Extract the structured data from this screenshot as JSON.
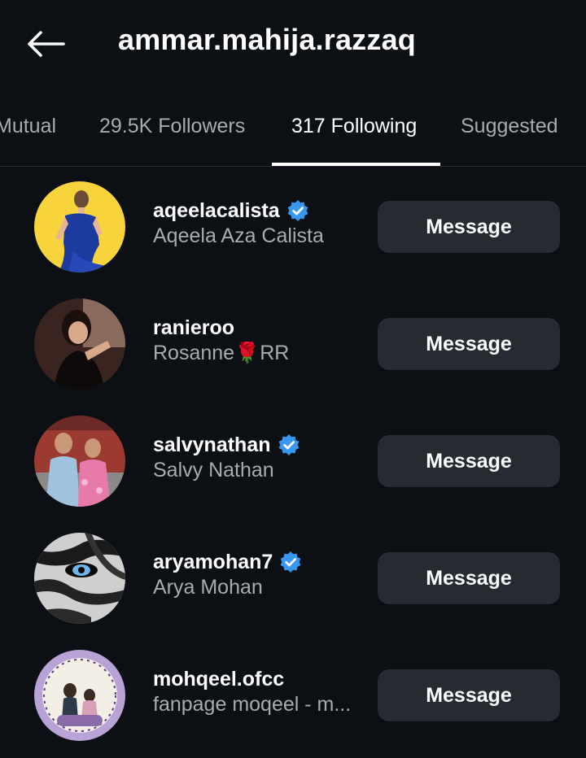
{
  "header": {
    "title": "ammar.mahija.razzaq",
    "back_icon": "arrow-left-icon"
  },
  "tabs": [
    {
      "label": "Mutual",
      "active": false
    },
    {
      "label": "29.5K Followers",
      "active": false
    },
    {
      "label": "317 Following",
      "active": true
    },
    {
      "label": "Suggested",
      "active": false
    }
  ],
  "colors": {
    "background": "#0c0f14",
    "button_bg": "#262a31",
    "secondary_text": "#a8abb0",
    "verified_blue": "#3897f0"
  },
  "list": [
    {
      "username": "aqeelacalista",
      "fullname": "Aqeela Aza Calista",
      "verified": true,
      "button_label": "Message"
    },
    {
      "username": "ranieroo",
      "fullname": "Rosanne🌹RR",
      "verified": false,
      "button_label": "Message"
    },
    {
      "username": "salvynathan",
      "fullname": "Salvy Nathan",
      "verified": true,
      "button_label": "Message"
    },
    {
      "username": "aryamohan7",
      "fullname": "Arya Mohan",
      "verified": true,
      "button_label": "Message"
    },
    {
      "username": "mohqeel.ofcc",
      "fullname": "fanpage moqeel - m...",
      "verified": false,
      "button_label": "Message"
    }
  ]
}
